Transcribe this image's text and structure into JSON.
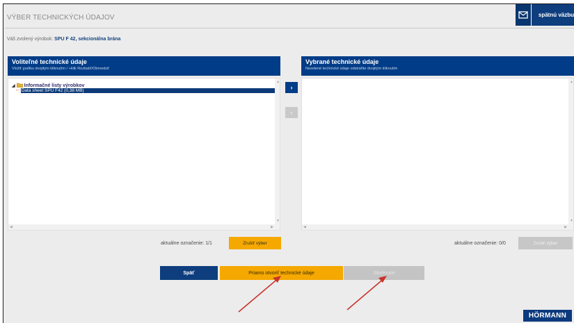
{
  "header": {
    "title": "VÝBER TECHNICKÝCH ÚDAJOV",
    "feedback_label": "spätnú väzbu",
    "mail_icon": "mail-icon"
  },
  "product": {
    "label": "Váš zvolený výrobok:",
    "value": "SPU F 42, sekcionálna brána"
  },
  "left_panel": {
    "title": "Voliteľné technické údaje",
    "subtitle": "Vložiť grafiku dvojitým kliknutím / +klik Rozbaliť/Obmedziť",
    "folder_label": "Informačné listy výrobkov",
    "item_label": "Data sheet SPU F42 (0,38 MB)",
    "selection_label": "aktuálne označenie: 1/1",
    "clear_label": "Zrušiť výber"
  },
  "right_panel": {
    "title": "Vybrané technické údaje",
    "subtitle": "Nezelené technické údaje odstráňte dvojitým kliknutím",
    "selection_label": "aktuálne označenie: 0/0",
    "clear_label": "Zrušiť výber"
  },
  "move_buttons": {
    "right_glyph": "›",
    "left_glyph": "‹"
  },
  "actions": {
    "back_label": "Späť",
    "open_label": "Priamo otvoriť technické údaje",
    "download_label": "Stiahnutie"
  },
  "brand": {
    "logo_text": "HÖRMANN",
    "accent": "#f5a800",
    "primary": "#0e3e7e"
  }
}
